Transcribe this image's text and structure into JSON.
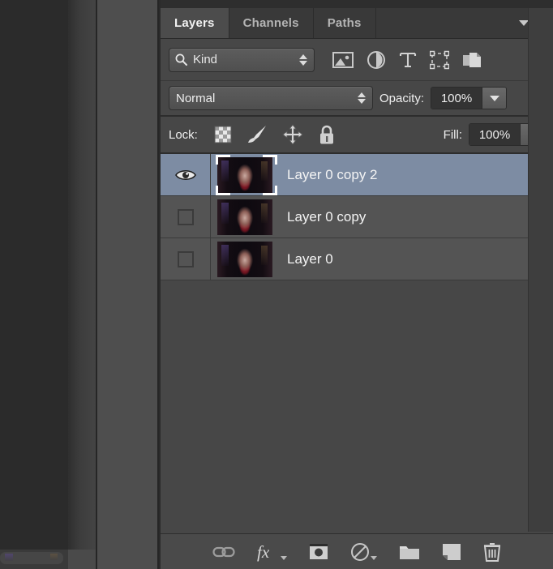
{
  "window": {
    "app": "Adobe Photoshop",
    "panel_title": "Layers"
  },
  "tabs": [
    {
      "label": "Layers",
      "active": true
    },
    {
      "label": "Channels",
      "active": false
    },
    {
      "label": "Paths",
      "active": false
    }
  ],
  "panel_menu": {
    "icon": "panel-menu-icon"
  },
  "filter_row": {
    "kind_label": "Kind",
    "search_icon": "search-icon",
    "icons": [
      {
        "name": "filter-pixel-layers-icon",
        "title": "Filter for pixel layers"
      },
      {
        "name": "filter-adjustment-layers-icon",
        "title": "Filter for adjustment layers"
      },
      {
        "name": "filter-type-layers-icon",
        "title": "Filter for type layers"
      },
      {
        "name": "filter-shape-layers-icon",
        "title": "Filter for shape layers"
      },
      {
        "name": "filter-smart-object-icon",
        "title": "Filter for smart objects"
      }
    ],
    "toggle": {
      "name": "filter-enable-toggle",
      "state": "on"
    }
  },
  "blend_row": {
    "blend_mode": "Normal",
    "opacity_label": "Opacity:",
    "opacity_value": "100%"
  },
  "lock_row": {
    "lock_label": "Lock:",
    "icons": [
      {
        "name": "lock-transparent-pixels-icon"
      },
      {
        "name": "lock-image-pixels-icon"
      },
      {
        "name": "lock-position-icon"
      },
      {
        "name": "lock-all-icon"
      }
    ],
    "fill_label": "Fill:",
    "fill_value": "100%"
  },
  "layers": [
    {
      "name": "Layer 0 copy 2",
      "visible": true,
      "selected": true,
      "thumbnail": "portrait-red-dress-thumbnail"
    },
    {
      "name": "Layer 0 copy",
      "visible": false,
      "selected": false,
      "thumbnail": "portrait-red-dress-thumbnail"
    },
    {
      "name": "Layer 0",
      "visible": false,
      "selected": false,
      "thumbnail": "portrait-red-dress-thumbnail"
    }
  ],
  "footer_buttons": [
    {
      "name": "link-layers-button",
      "icon": "link-icon"
    },
    {
      "name": "layer-style-button",
      "icon": "fx-icon",
      "has_menu": true
    },
    {
      "name": "add-layer-mask-button",
      "icon": "layer-mask-icon"
    },
    {
      "name": "new-adjustment-layer-button",
      "icon": "adjustment-icon",
      "has_menu": true
    },
    {
      "name": "new-group-button",
      "icon": "folder-icon"
    },
    {
      "name": "new-layer-button",
      "icon": "new-layer-icon"
    },
    {
      "name": "delete-layer-button",
      "icon": "trash-icon"
    }
  ],
  "colors": {
    "panel_bg": "#474747",
    "row_bg": "#545454",
    "selected_row": "#7d8ca3",
    "tab_active": "#4c4c4c",
    "tab_inactive": "#393939",
    "text": "#f4f4f4"
  }
}
